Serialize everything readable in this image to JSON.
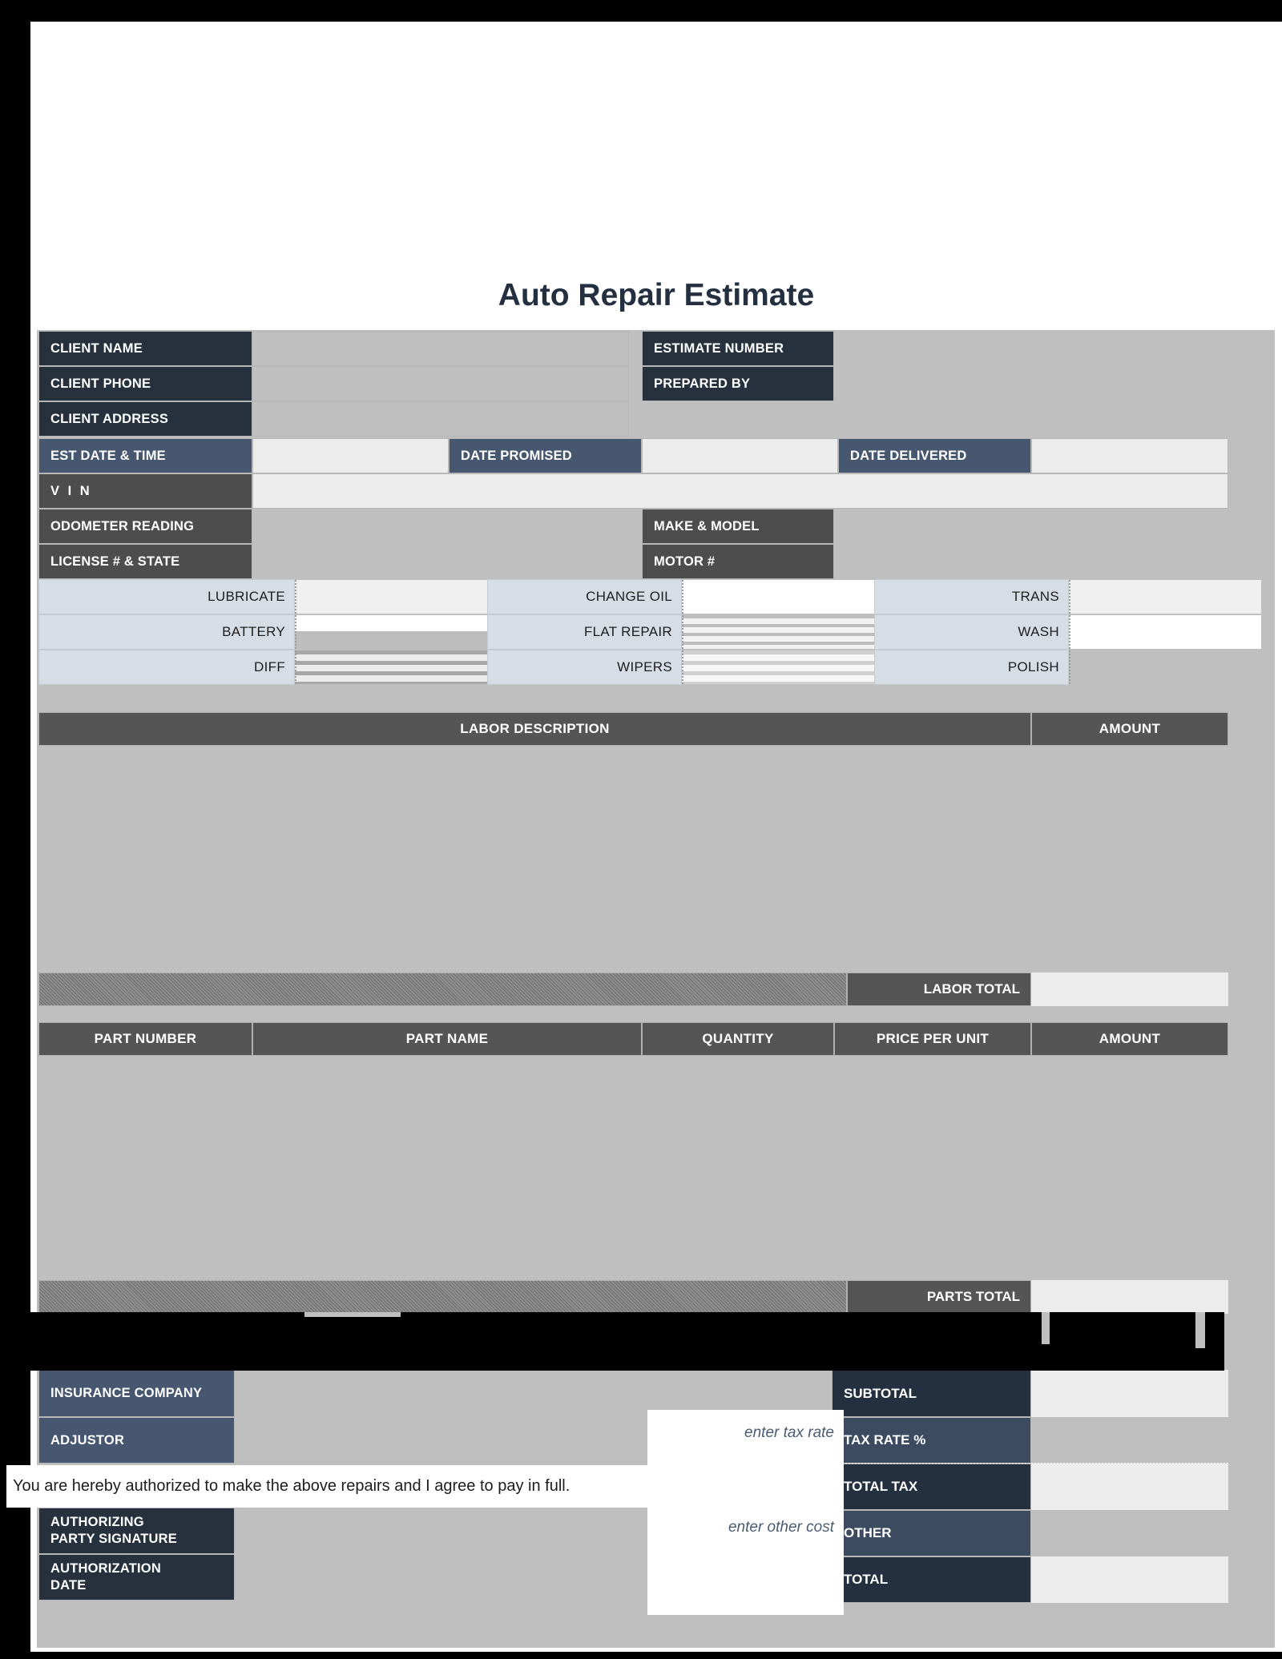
{
  "document": {
    "title": "Auto Repair Estimate"
  },
  "client_block": {
    "rows": [
      {
        "label": "CLIENT NAME",
        "value": ""
      },
      {
        "label": "CLIENT PHONE",
        "value": ""
      },
      {
        "label": "CLIENT ADDRESS",
        "value": ""
      }
    ]
  },
  "estimate_block": {
    "rows": [
      {
        "label": "ESTIMATE NUMBER",
        "value": ""
      },
      {
        "label": "PREPARED BY",
        "value": ""
      }
    ]
  },
  "date_row": {
    "cells": [
      {
        "label": "EST DATE & TIME",
        "value": ""
      },
      {
        "label": "DATE PROMISED",
        "value": ""
      },
      {
        "label": "DATE DELIVERED",
        "value": ""
      }
    ]
  },
  "vehicle_block": {
    "vin": {
      "label": "V I N",
      "value": ""
    },
    "odometer": {
      "label": "ODOMETER READING",
      "value": ""
    },
    "make_model": {
      "label": "MAKE & MODEL",
      "value": ""
    },
    "license": {
      "label": "LICENSE # & STATE",
      "value": ""
    },
    "motor": {
      "label": "MOTOR #",
      "value": ""
    }
  },
  "service_checklist": {
    "columns": [
      {
        "items": [
          {
            "label": "LUBRICATE",
            "value": ""
          },
          {
            "label": "BATTERY",
            "value": ""
          },
          {
            "label": "DIFF",
            "value": ""
          }
        ]
      },
      {
        "items": [
          {
            "label": "CHANGE OIL",
            "value": ""
          },
          {
            "label": "FLAT REPAIR",
            "value": ""
          },
          {
            "label": "WIPERS",
            "value": ""
          }
        ]
      },
      {
        "items": [
          {
            "label": "TRANS",
            "value": ""
          },
          {
            "label": "WASH",
            "value": ""
          },
          {
            "label": "POLISH",
            "value": ""
          }
        ]
      }
    ]
  },
  "labor_table": {
    "headers": [
      "LABOR DESCRIPTION",
      "AMOUNT"
    ],
    "rows": [],
    "total_label": "LABOR TOTAL",
    "total_value": ""
  },
  "parts_table": {
    "headers": [
      "PART NUMBER",
      "PART NAME",
      "QUANTITY",
      "PRICE PER UNIT",
      "AMOUNT"
    ],
    "rows": [],
    "total_label": "PARTS TOTAL",
    "total_value": ""
  },
  "insurance_block": {
    "rows": [
      {
        "label": "INSURANCE COMPANY",
        "value": ""
      },
      {
        "label": "ADJUSTOR",
        "value": ""
      }
    ]
  },
  "authorization": {
    "statement": "You are hereby authorized to make the above repairs and I agree to pay in full.",
    "signature_label_line1": "AUTHORIZING",
    "signature_label_line2": "PARTY SIGNATURE",
    "signature_value": "",
    "date_label_line1": "AUTHORIZATION",
    "date_label_line2": "DATE",
    "date_value": ""
  },
  "totals": {
    "rows": [
      {
        "label": "SUBTOTAL",
        "value": "",
        "hint": ""
      },
      {
        "label": "TAX RATE %",
        "value": "",
        "hint": "enter tax rate"
      },
      {
        "label": "TOTAL TAX",
        "value": "",
        "hint": ""
      },
      {
        "label": "OTHER",
        "value": "",
        "hint": "enter other cost"
      },
      {
        "label": "TOTAL",
        "value": "",
        "hint": ""
      }
    ]
  },
  "colors": {
    "dark_navy": "#24303f",
    "slate_blue": "#47576f",
    "gray_header": "#4d4d4d",
    "section_header": "#555555",
    "field_gray": "#bfbfbf",
    "field_light": "#ececec",
    "checklist_blue": "#d6dde5"
  }
}
